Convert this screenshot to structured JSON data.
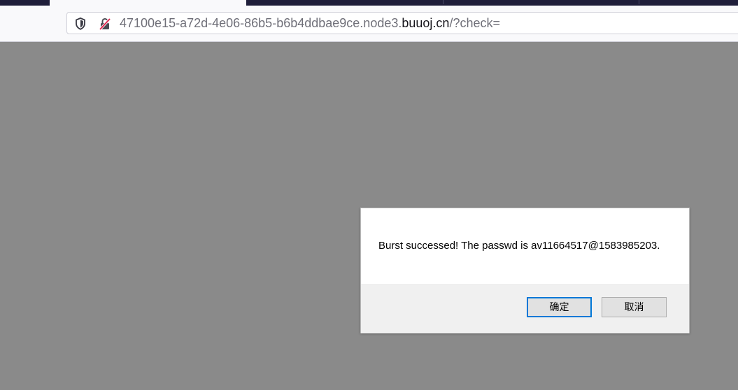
{
  "browser": {
    "url_prefix": "47100e15-a72d-4e06-86b5-b6b4ddbae9ce.node3.",
    "url_host": "buuoj.cn",
    "url_suffix": "/?check=",
    "icons": [
      "shield-icon",
      "insecure-connection-icon"
    ]
  },
  "dialog": {
    "message": "Burst successed! The passwd is av11664517@1583985203.",
    "ok_label": "确定",
    "cancel_label": "取消"
  },
  "colors": {
    "page_overlay": "#8a8a8a",
    "tabstrip": "#1f1e3a",
    "primary_button_border": "#0078d7",
    "insecure_slash": "#e22850"
  }
}
